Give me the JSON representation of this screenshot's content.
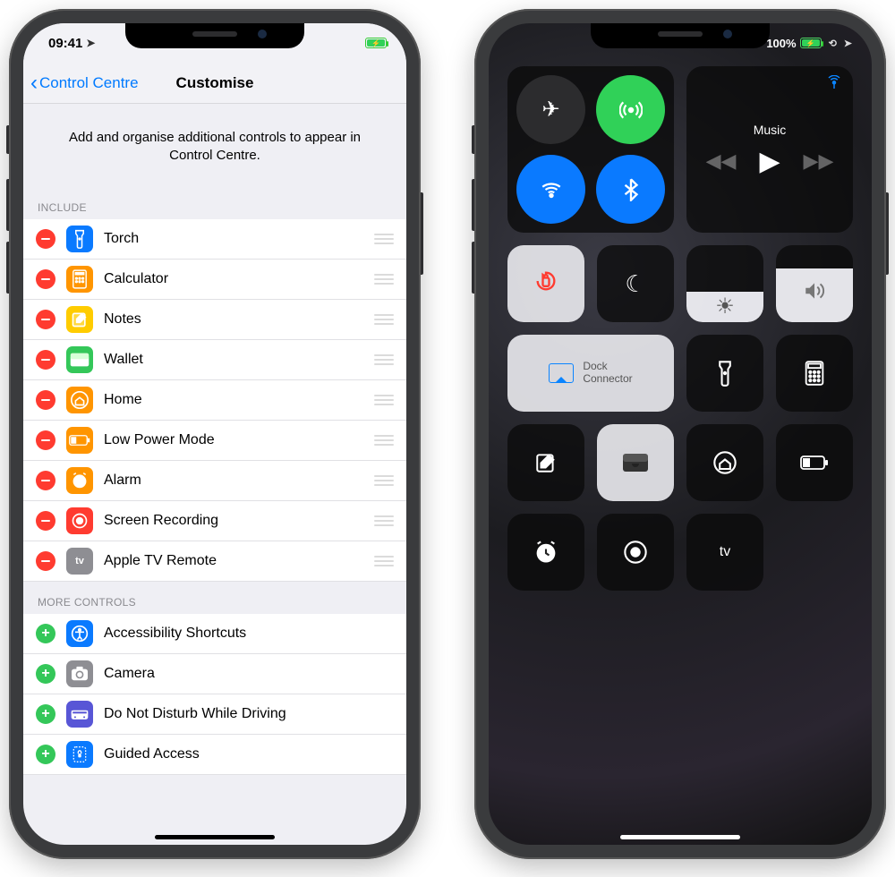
{
  "left": {
    "status": {
      "time": "09:41"
    },
    "nav": {
      "back": "Control Centre",
      "title": "Customise"
    },
    "description": "Add and organise additional controls to appear in Control Centre.",
    "include_header": "INCLUDE",
    "include": [
      {
        "label": "Torch",
        "icon": "torch-icon",
        "color": "#0a7aff"
      },
      {
        "label": "Calculator",
        "icon": "calc-icon",
        "color": "#ff9500"
      },
      {
        "label": "Notes",
        "icon": "notes-icon",
        "color": "#ffcc00"
      },
      {
        "label": "Wallet",
        "icon": "wallet-icon",
        "color": "#34c759"
      },
      {
        "label": "Home",
        "icon": "home-icon",
        "color": "#ff9500"
      },
      {
        "label": "Low Power Mode",
        "icon": "lpm-icon",
        "color": "#ff9500"
      },
      {
        "label": "Alarm",
        "icon": "alarm-icon",
        "color": "#ff9500"
      },
      {
        "label": "Screen Recording",
        "icon": "record-icon",
        "color": "#ff3b30"
      },
      {
        "label": "Apple TV Remote",
        "icon": "atv-icon",
        "color": "#8e8e93"
      }
    ],
    "more_header": "MORE CONTROLS",
    "more": [
      {
        "label": "Accessibility Shortcuts",
        "icon": "access-icon",
        "color": "#0a7aff"
      },
      {
        "label": "Camera",
        "icon": "camera-icon",
        "color": "#8e8e93"
      },
      {
        "label": "Do Not Disturb While Driving",
        "icon": "dnd-icon",
        "color": "#5856d6"
      },
      {
        "label": "Guided Access",
        "icon": "guided-icon",
        "color": "#0a7aff"
      }
    ]
  },
  "right": {
    "status": {
      "pct": "100%"
    },
    "music": {
      "title": "Music"
    },
    "mirror": {
      "line1": "Dock",
      "line2": "Connector"
    },
    "brightness_pct": 40,
    "volume_pct": 70,
    "tv_label": "tv"
  }
}
